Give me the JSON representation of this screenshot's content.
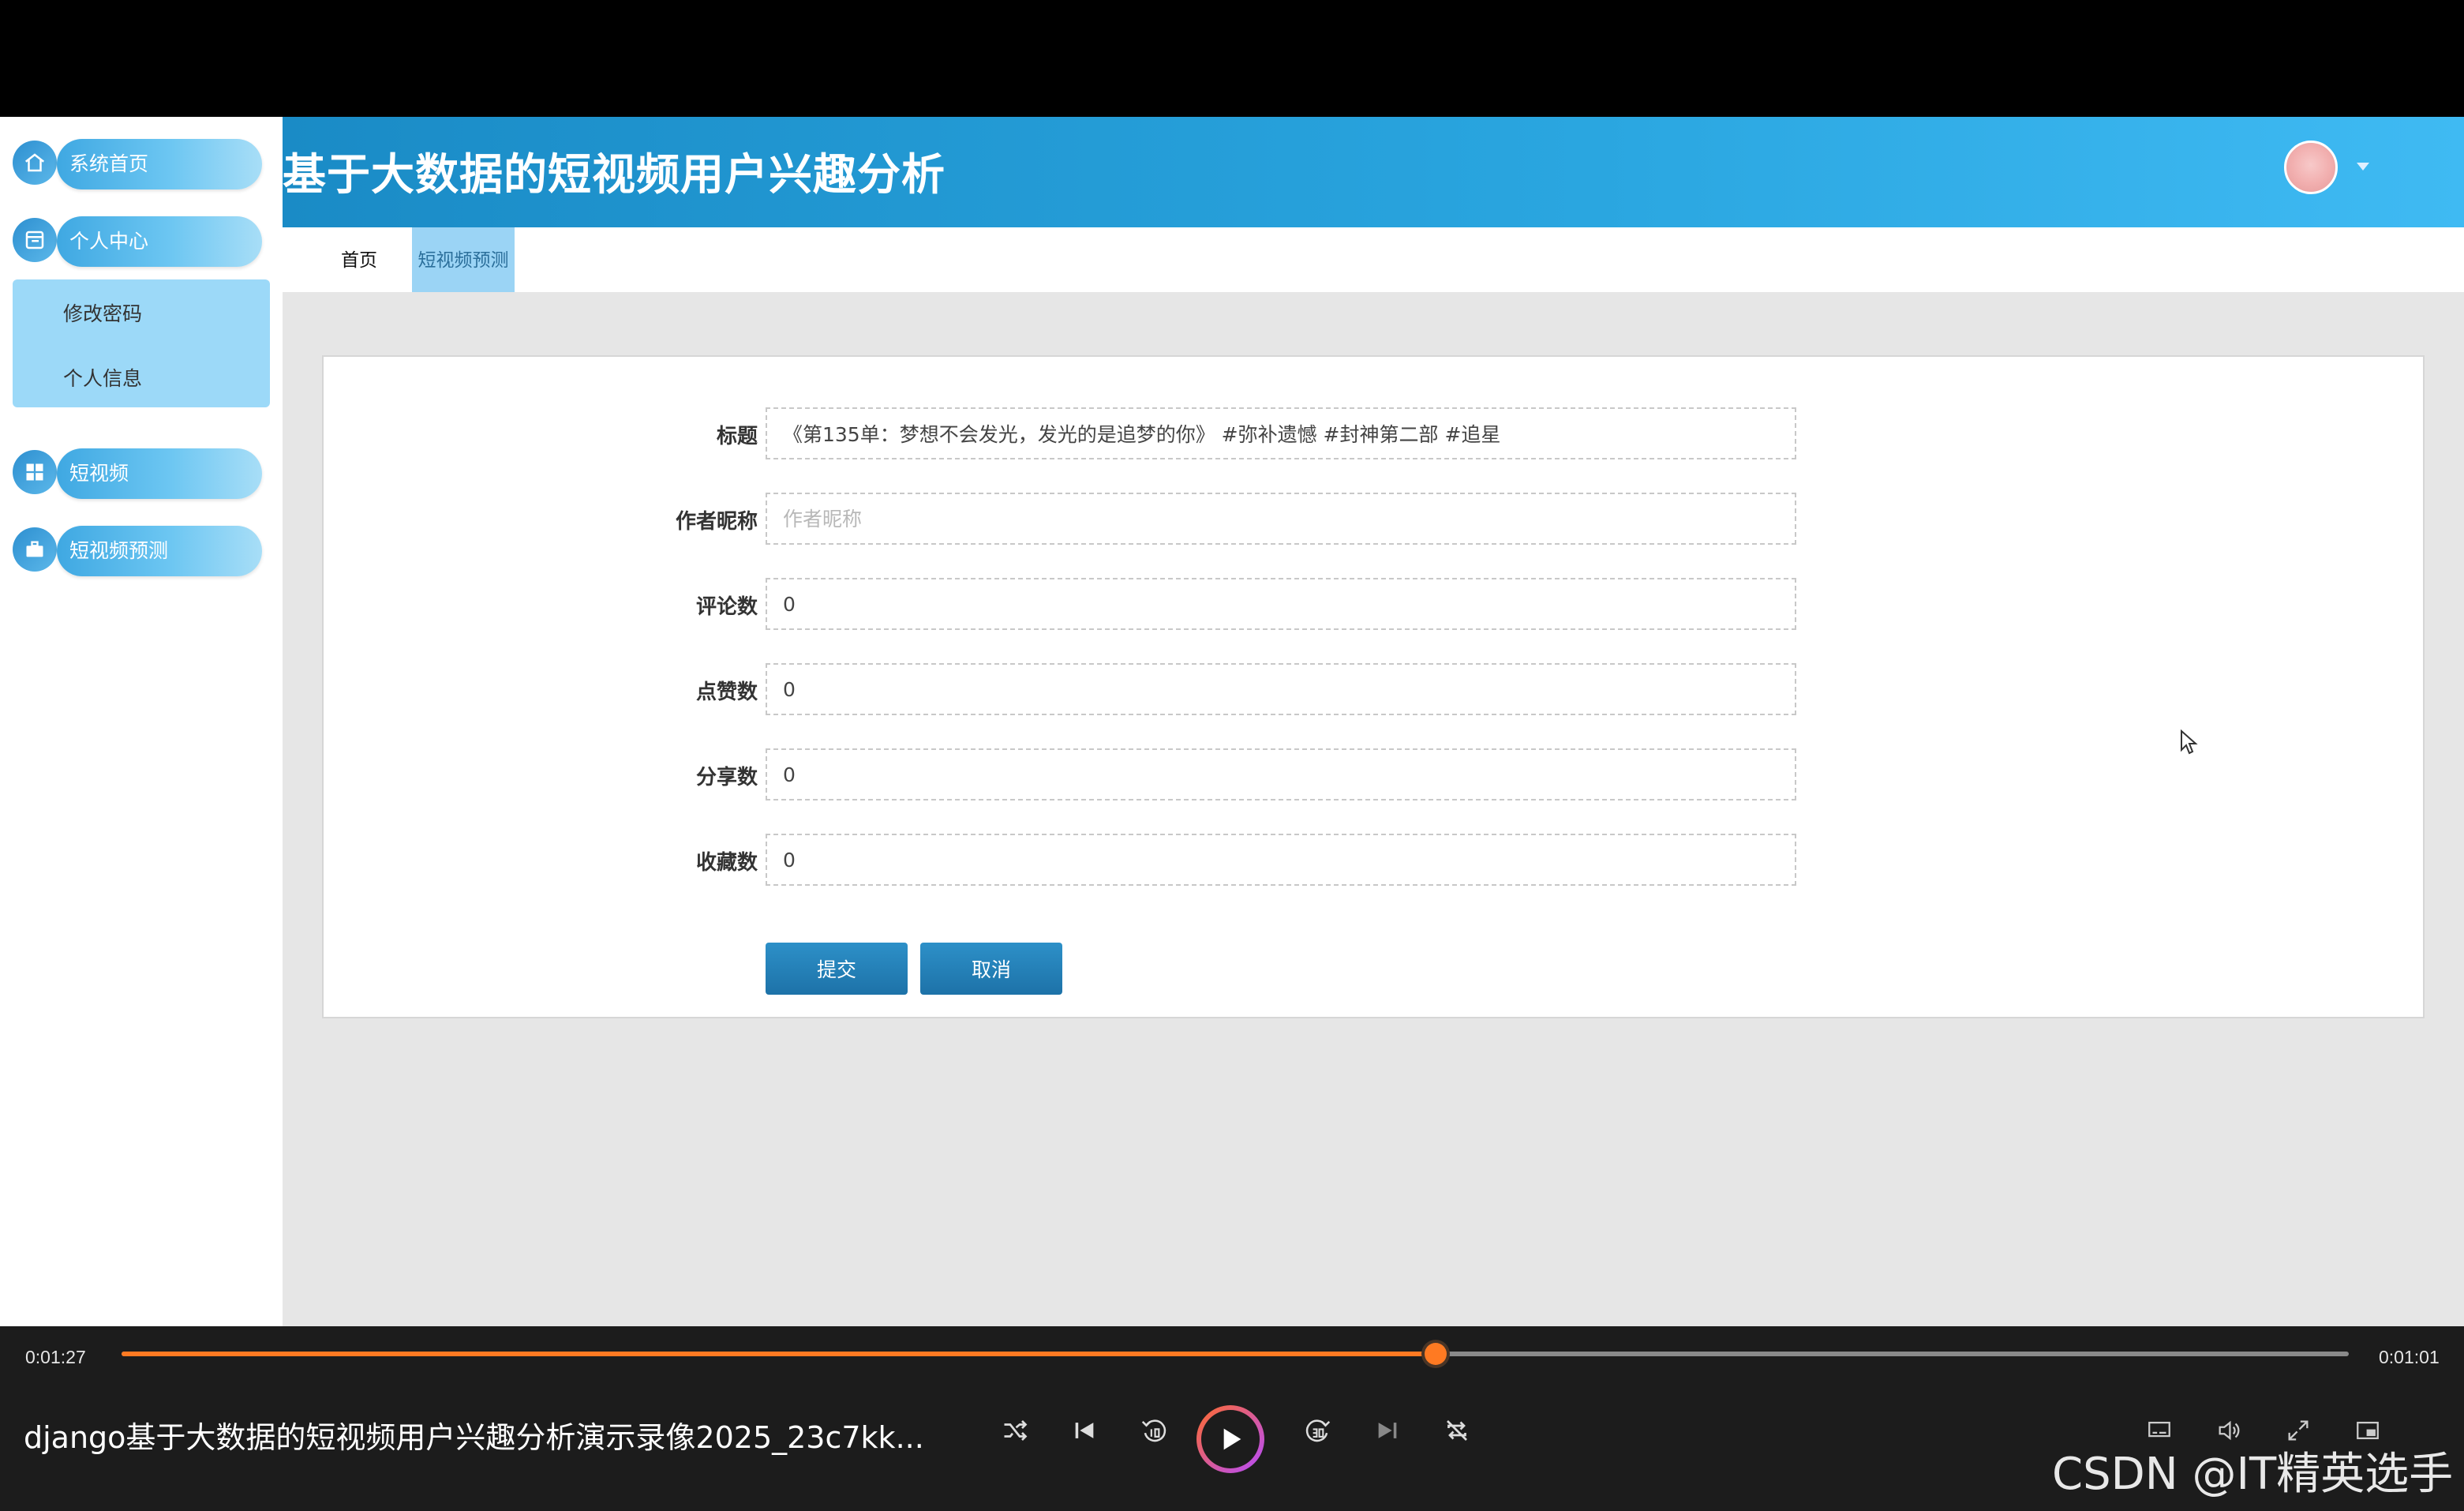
{
  "app": {
    "title": "基于大数据的短视频用户兴趣分析",
    "sidebar": {
      "items": [
        {
          "label": "系统首页",
          "icon": "home-icon"
        },
        {
          "label": "个人中心",
          "icon": "user-center-icon",
          "children": [
            "修改密码",
            "个人信息"
          ]
        },
        {
          "label": "短视频",
          "icon": "grid-icon"
        },
        {
          "label": "短视频预测",
          "icon": "briefcase-icon"
        }
      ]
    },
    "tabs": [
      {
        "label": "首页",
        "active": false
      },
      {
        "label": "短视频预测",
        "active": true
      }
    ],
    "form": {
      "fields": [
        {
          "label": "标题",
          "value": "《第135单：梦想不会发光，发光的是追梦的你》 #弥补遗憾 #封神第二部 #追星",
          "placeholder": ""
        },
        {
          "label": "作者昵称",
          "value": "",
          "placeholder": "作者昵称"
        },
        {
          "label": "评论数",
          "value": "0",
          "placeholder": ""
        },
        {
          "label": "点赞数",
          "value": "0",
          "placeholder": ""
        },
        {
          "label": "分享数",
          "value": "0",
          "placeholder": ""
        },
        {
          "label": "收藏数",
          "value": "0",
          "placeholder": ""
        }
      ],
      "submit_label": "提交",
      "cancel_label": "取消"
    },
    "accent_color": "#2aa6e0"
  },
  "player": {
    "current_time": "0:01:27",
    "remaining_time": "0:01:01",
    "progress": 0.59,
    "video_title": "django基于大数据的短视频用户兴趣分析演示录像2025_23c7kk...",
    "watermark": "CSDN @IT精英选手",
    "accent_color": "#ff7a22"
  }
}
